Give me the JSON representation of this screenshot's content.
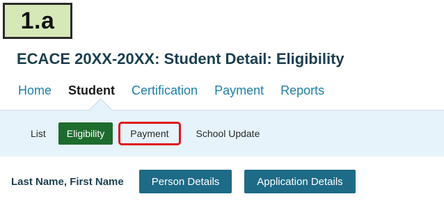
{
  "step_badge": "1.a",
  "header": {
    "title": "ECACE 20XX-20XX: Student Detail: Eligibility"
  },
  "primary_nav": {
    "items": [
      {
        "label": "Home",
        "active": false
      },
      {
        "label": "Student",
        "active": true
      },
      {
        "label": "Certification",
        "active": false
      },
      {
        "label": "Payment",
        "active": false
      },
      {
        "label": "Reports",
        "active": false
      }
    ]
  },
  "sub_nav": {
    "items": [
      {
        "label": "List",
        "active": false
      },
      {
        "label": "Eligibility",
        "active": true
      },
      {
        "label": "Payment",
        "highlighted": true
      },
      {
        "label": "School Update",
        "active": false
      }
    ]
  },
  "person": {
    "name": "Last Name, First Name",
    "buttons": {
      "person_details": "Person Details",
      "application_details": "Application Details"
    }
  },
  "colors": {
    "title": "#1b3f4f",
    "link": "#1e7fa8",
    "active_subnav": "#1e6b2e",
    "highlight": "#e0141b",
    "button": "#1e6b87",
    "band": "#e6f3fa",
    "badge": "#d6e8b8"
  }
}
